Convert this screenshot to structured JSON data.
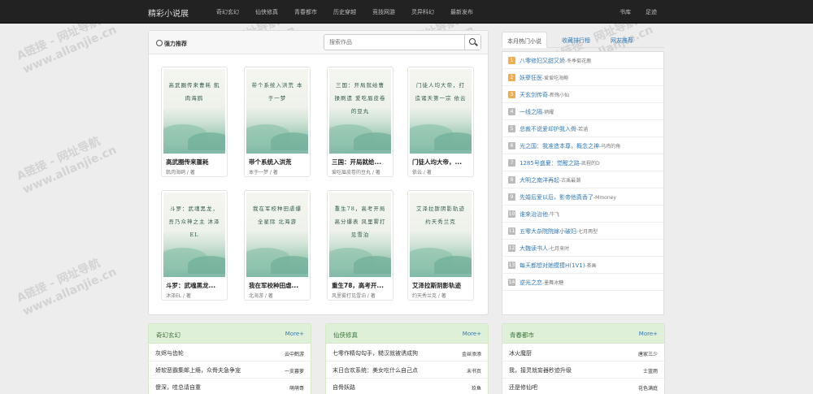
{
  "navbar": {
    "brand": "精彩小说展",
    "links": [
      "奇幻玄幻",
      "仙侠修真",
      "青春都市",
      "历史穿越",
      "竞技网游",
      "灵异科幻",
      "最新发布"
    ],
    "right_links": [
      "书库",
      "足迹"
    ]
  },
  "recommend": {
    "title": "强力推荐",
    "search_placeholder": "搜索作品",
    "books": [
      {
        "cover": "高武圈传来曹耗 飢肉海鸥",
        "title": "高武圈传来噩耗",
        "author": "飢肉海鸥 / 著"
      },
      {
        "cover": "带个系统入洪荒 本于一梦",
        "title": "带个系统入洪荒",
        "author": "本于一梦 / 著"
      },
      {
        "cover": "三国：开局就给曹操刷遗 爱吃眉皮卷的豆丸",
        "title": "三国：开局就给...",
        "author": "爱吃眉皮卷的豆丸 / 著"
      },
      {
        "cover": "门徒人均大帝，打造诸天第一宗 依云",
        "title": "门徒人均大帝，...",
        "author": "依云 / 著"
      },
      {
        "cover": "斗罗：武魂黑龙，吾乃众神之主 沐泽EL",
        "title": "斗罗：武魂黑龙...",
        "author": "沐泽EL / 著"
      },
      {
        "cover": "我在军校种田虐爆全星际 北海游",
        "title": "我在军校种田虐...",
        "author": "北海游 / 著"
      },
      {
        "cover": "重生78，高考开局高分爆表 风里雾打见雪泊",
        "title": "重生78，高考开...",
        "author": "风里雾打见雪泊 / 著"
      },
      {
        "cover": "艾泽拉斯阴影轨迹 约天秀兰克",
        "title": "艾泽拉斯阴影轨迹",
        "author": "约天秀兰克 / 著"
      }
    ]
  },
  "ranking": {
    "tabs": [
      "本月热门小说",
      "收藏排行榜",
      "网友推荐"
    ],
    "items": [
      {
        "num": "1",
        "title": "八零修妇又甜又娇",
        "author": "-冬季菊花鹿"
      },
      {
        "num": "2",
        "title": "妖孽狂医",
        "author": "-爱爱吃海鲍"
      },
      {
        "num": "3",
        "title": "天玄剑传奇",
        "author": "-新殇小仙"
      },
      {
        "num": "4",
        "title": "一线之隔",
        "author": "-炳耀"
      },
      {
        "num": "5",
        "title": "总裁不说爱却护我入骨",
        "author": "-若涵"
      },
      {
        "num": "6",
        "title": "光之国：我准造本尊，概念之神",
        "author": "-乌鸡的角"
      },
      {
        "num": "7",
        "title": "1285号盛夏：觉醒之路",
        "author": "-凯程的D"
      },
      {
        "num": "8",
        "title": "大明之南洋再起",
        "author": "-古禹最潮"
      },
      {
        "num": "9",
        "title": "先婚后爱以后，影帝他真香了",
        "author": "-Mmoney"
      },
      {
        "num": "10",
        "title": "谁来治治他",
        "author": "-牛飞"
      },
      {
        "num": "11",
        "title": "五零大杂院院嫁小破妇",
        "author": "-七月两型"
      },
      {
        "num": "12",
        "title": "大魏读书人",
        "author": "-七月来时"
      },
      {
        "num": "13",
        "title": "每天都想对她摸摸H(1V1)",
        "author": "-茶画"
      },
      {
        "num": "14",
        "title": "逆光之恋",
        "author": "-墨舞冰糖"
      }
    ]
  },
  "categories": [
    {
      "title": "奇幻玄幻",
      "more": "More+",
      "rows": [
        {
          "name": "灰烬与齿轮",
          "author": "云中鹤游"
        },
        {
          "name": "娇软恶霸集邮上瘾，众骨夫急争宠",
          "author": "一支暮萝"
        },
        {
          "name": "傻深，哇总请自重",
          "author": "萌萌哥"
        }
      ]
    },
    {
      "title": "仙侠修真",
      "more": "More+",
      "rows": [
        {
          "name": "七零作精勾勾手，糙汉就被诱成狗",
          "author": "金丝添添"
        },
        {
          "name": "末日合欢系统：美女吃什么自己点",
          "author": "未书页"
        },
        {
          "name": "自骨妖路",
          "author": "玖鱼"
        }
      ]
    },
    {
      "title": "青春都市",
      "more": "More+",
      "rows": [
        {
          "name": "冰火魔厨",
          "author": "唐家三少"
        },
        {
          "name": "我，接灵就妄器秒迹升级",
          "author": "士蓝雨"
        },
        {
          "name": "还是修仙吧",
          "author": "花色满庭"
        }
      ]
    }
  ],
  "watermark": {
    "line1": "A链接 - 网址导航",
    "line2": "www.allanjie.cn"
  },
  "colors": {
    "rank_top": "#f0ad4e",
    "rank_other": "#bbb",
    "accent_link": "#337ab7",
    "panel_green": "#dff0d8"
  }
}
